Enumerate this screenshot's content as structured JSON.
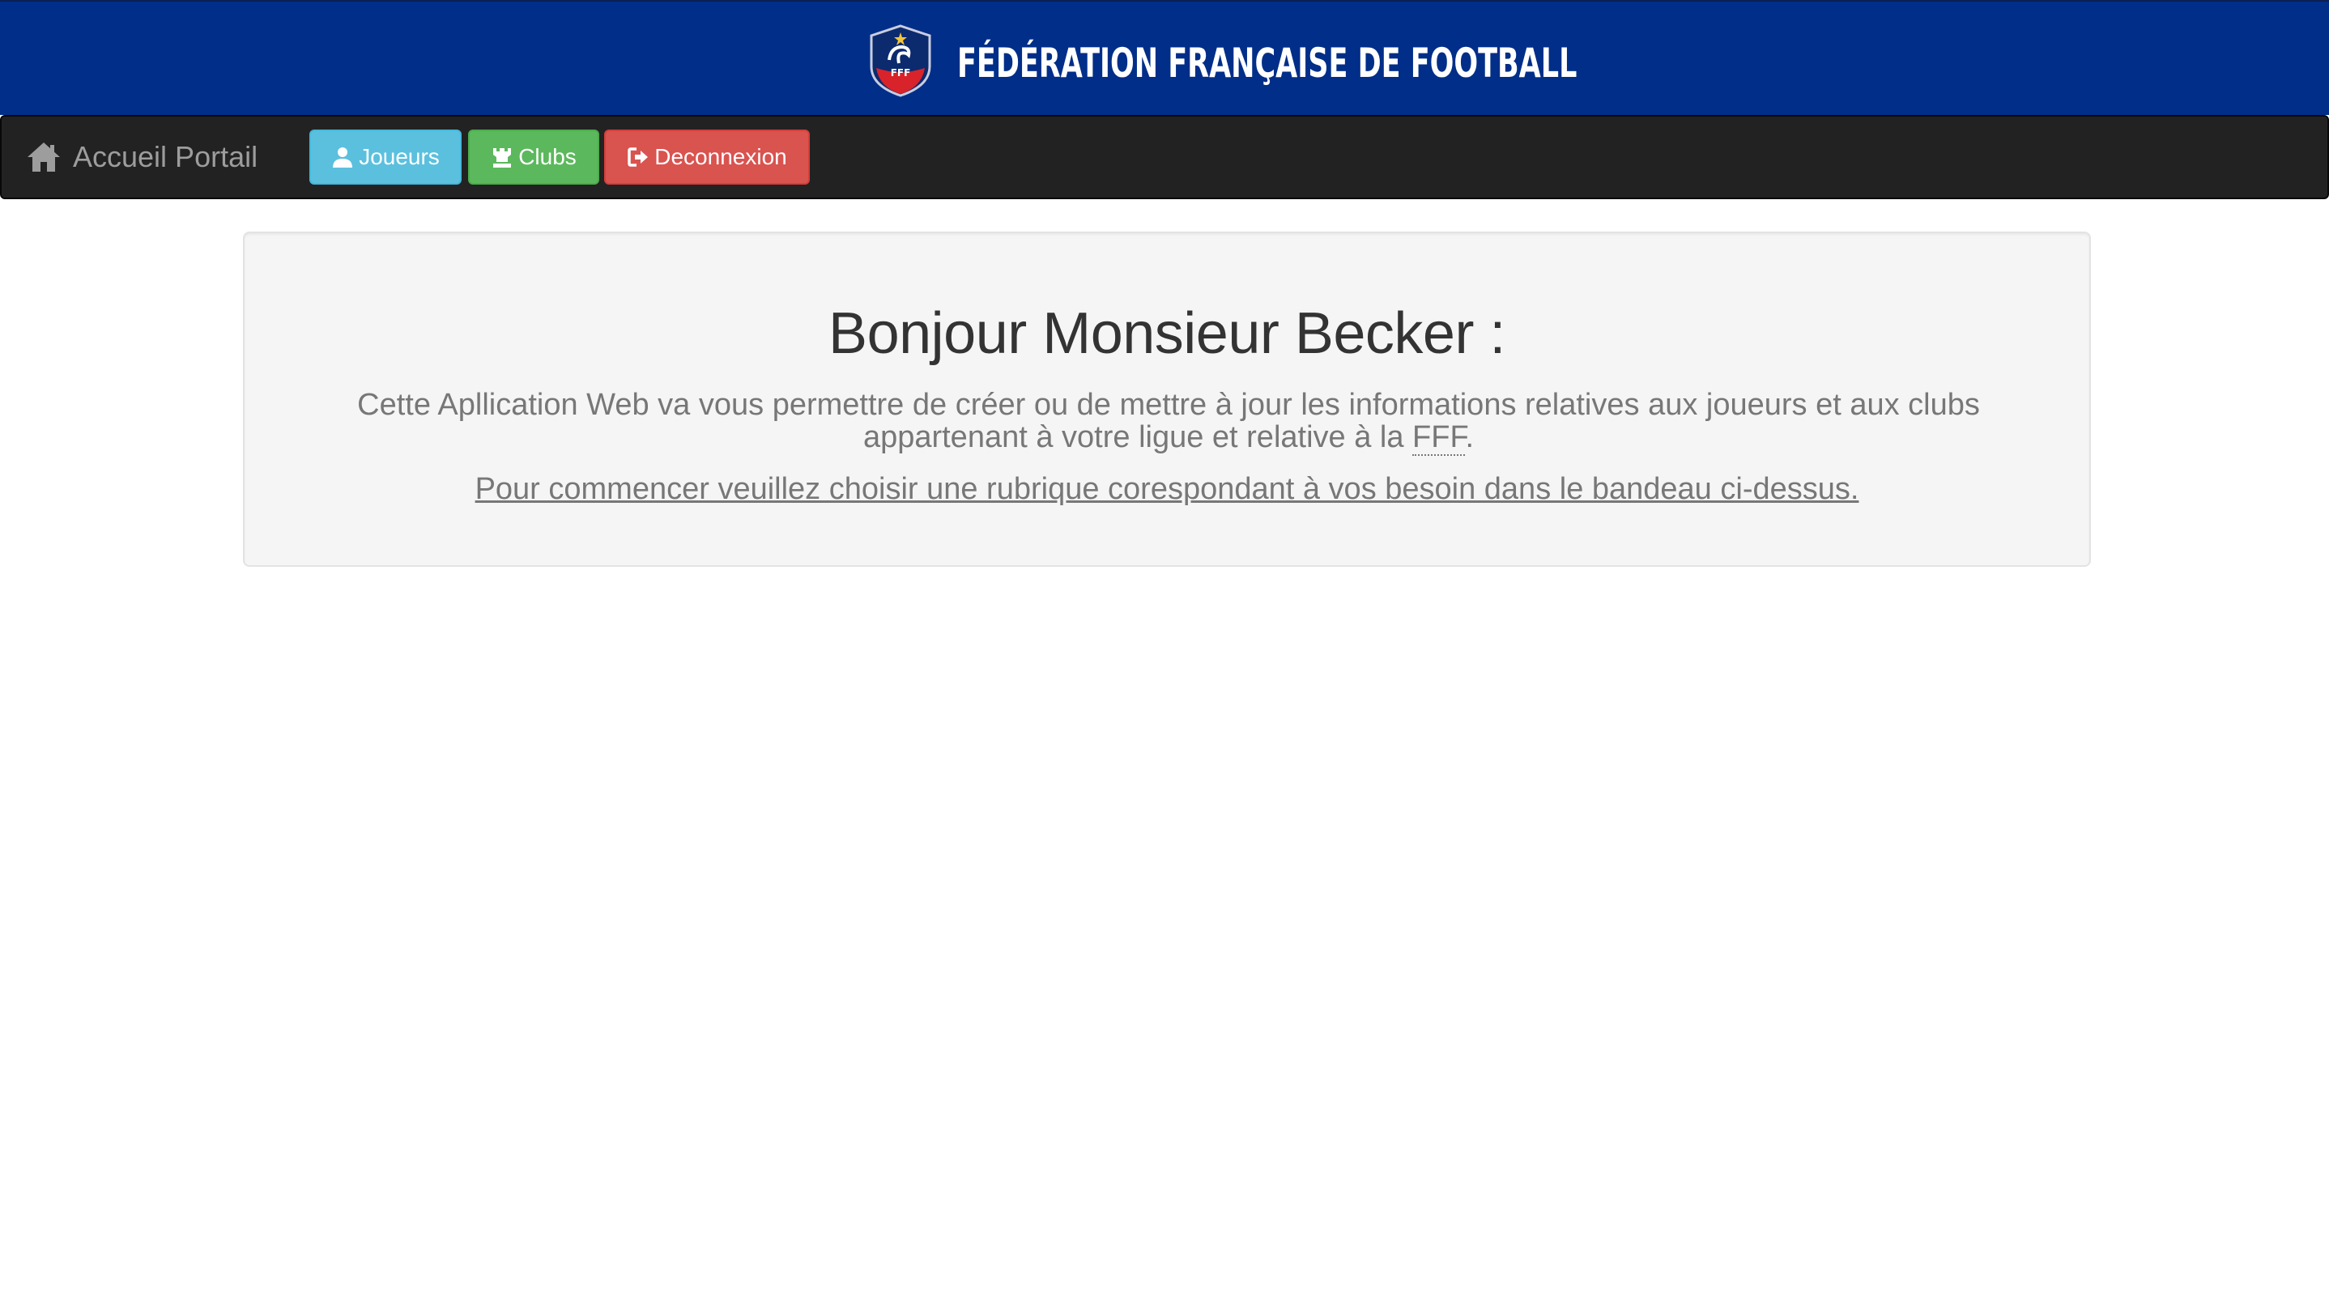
{
  "banner": {
    "title": "FÉDÉRATION FRANÇAISE DE FOOTBALL",
    "logo_letters": "FFF",
    "color": "#002e88"
  },
  "navbar": {
    "brand_label": "Accueil Portail",
    "brand_icon": "home-icon",
    "buttons": [
      {
        "label": "Joueurs",
        "icon": "user-icon",
        "color": "#5bc0de"
      },
      {
        "label": "Clubs",
        "icon": "tower-icon",
        "color": "#5cb85c"
      },
      {
        "label": "Deconnexion",
        "icon": "logout-icon",
        "color": "#d9534f"
      }
    ]
  },
  "main": {
    "greeting": "Bonjour Monsieur Becker :",
    "intro_text": "Cette Apllication Web va vous permettre de créer ou de mettre à jour les informations relatives aux joueurs et aux clubs appartenant à votre ligue et relative à la",
    "intro_abbr": "FFF",
    "intro_end": ".",
    "hint": "Pour commencer veuillez choisir une rubrique corespondant à vos besoin dans le bandeau ci-dessus."
  }
}
